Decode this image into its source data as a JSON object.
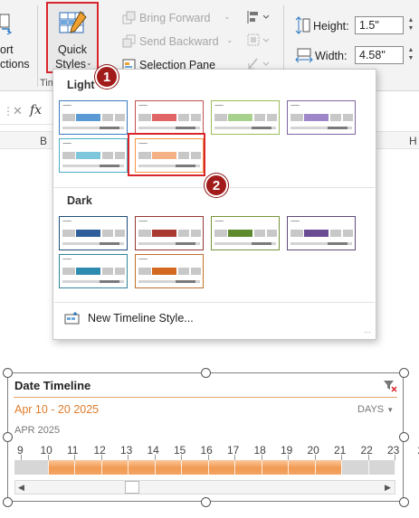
{
  "ribbon": {
    "import_partial_1": "ort",
    "import_partial_2": "ctions",
    "quick_styles_line1": "Quick",
    "quick_styles_line2": "Styles",
    "bring_forward": "Bring Forward",
    "send_backward": "Send Backward",
    "selection_pane": "Selection Pane",
    "group_label_partial": "Tim",
    "height_label": "Height:",
    "height_value": "1.5\"",
    "width_label": "Width:",
    "width_value": "4.58\""
  },
  "formula_bar": {
    "fx": "fx"
  },
  "columns": [
    "B",
    "H"
  ],
  "gallery": {
    "light_label": "Light",
    "dark_label": "Dark",
    "new_style": "New Timeline Style...",
    "light_styles": [
      {
        "border": "#3a7abf",
        "color": "#5b9bd5"
      },
      {
        "border": "#c0504d",
        "color": "#e06666"
      },
      {
        "border": "#9bbb59",
        "color": "#a9d18e"
      },
      {
        "border": "#8064a2",
        "color": "#9e86c8"
      },
      {
        "border": "#4bacc6",
        "color": "#7ec6dc"
      },
      {
        "border": "#f79646",
        "color": "#f4b183"
      }
    ],
    "dark_styles": [
      {
        "border": "#1f4e79",
        "color": "#2e5f9a"
      },
      {
        "border": "#943634",
        "color": "#a93a32"
      },
      {
        "border": "#76923c",
        "color": "#5e8a2e"
      },
      {
        "border": "#5f497a",
        "color": "#6a4c93"
      },
      {
        "border": "#31859b",
        "color": "#2e8bb0"
      },
      {
        "border": "#c0712a",
        "color": "#d2691e"
      }
    ]
  },
  "badges": {
    "one": "1",
    "two": "2"
  },
  "timeline": {
    "title": "Date Timeline",
    "range": "Apr 10 - 20 2025",
    "level": "DAYS",
    "month": "APR 2025",
    "days": [
      "9",
      "10",
      "11",
      "12",
      "13",
      "14",
      "15",
      "16",
      "17",
      "18",
      "19",
      "20",
      "21",
      "22",
      "23",
      "2"
    ],
    "selected_from": "10",
    "selected_to": "20",
    "accent": "#e07b2a"
  }
}
